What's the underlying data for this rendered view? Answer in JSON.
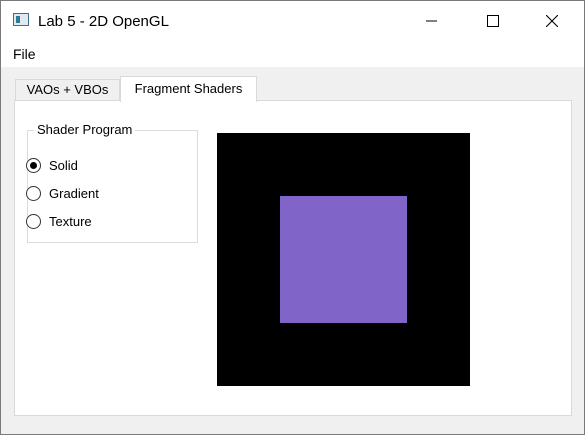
{
  "window": {
    "title": "Lab 5 - 2D OpenGL",
    "controls": {
      "minimize": "minimize-icon",
      "maximize": "maximize-icon",
      "close": "close-icon"
    }
  },
  "menu": {
    "file": "File"
  },
  "tabs": [
    {
      "label": "VAOs + VBOs",
      "active": false
    },
    {
      "label": "Fragment Shaders",
      "active": true
    }
  ],
  "shader_group": {
    "title": "Shader Program",
    "options": [
      {
        "label": "Solid",
        "checked": true
      },
      {
        "label": "Gradient",
        "checked": false
      },
      {
        "label": "Texture",
        "checked": false
      }
    ]
  },
  "canvas": {
    "background": "#000000",
    "square_color": "#8064c8"
  }
}
